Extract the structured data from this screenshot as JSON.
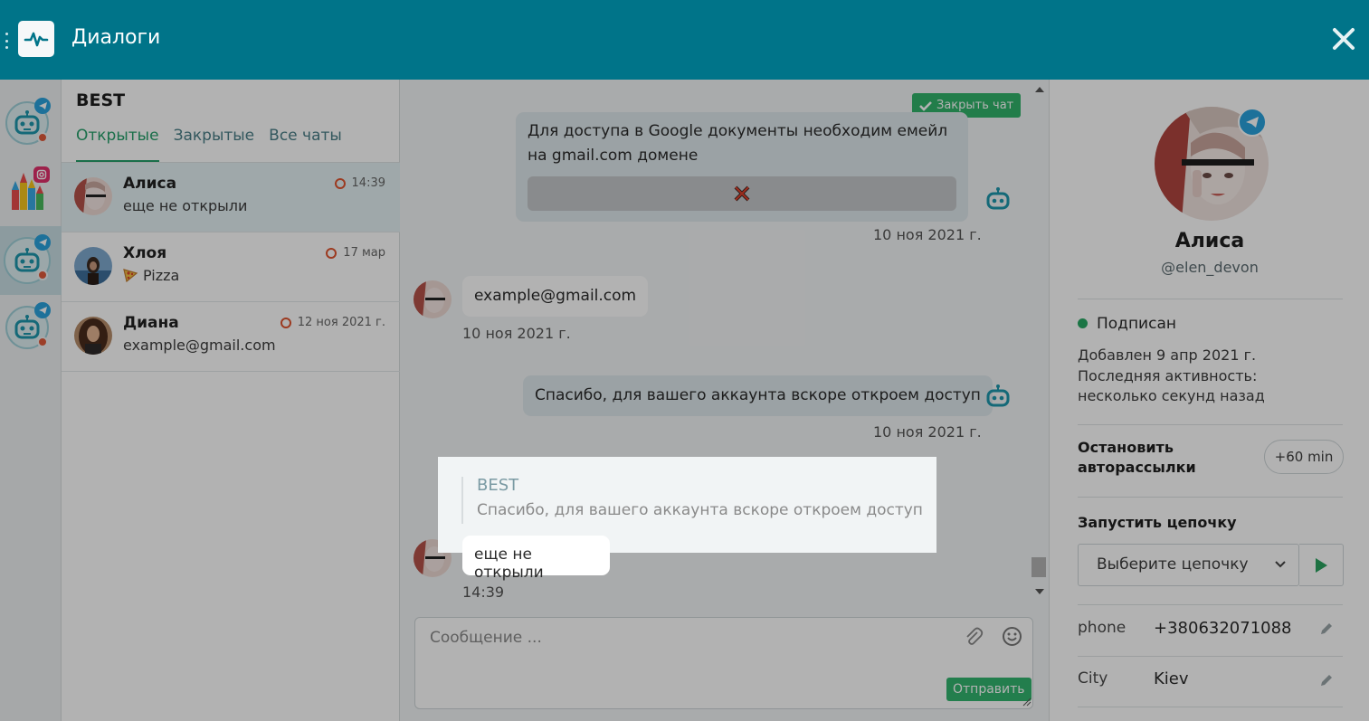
{
  "app": {
    "title": "Диалоги"
  },
  "colors": {
    "topbar": "#007489",
    "accent": "#26a06b",
    "close_chat": "#32b46b",
    "unread": "#e05a3a",
    "telegram": "#2aa3dd",
    "instagram": "#e1306c"
  },
  "channels": [
    {
      "icon": "robot-icon",
      "badge": "telegram-icon"
    },
    {
      "icon": "castle-icon",
      "badge": "instagram-icon"
    },
    {
      "icon": "robot-icon",
      "badge": "telegram-icon"
    },
    {
      "icon": "robot-icon",
      "badge": "telegram-icon"
    }
  ],
  "chatlist": {
    "workspace": "BEST",
    "tabs": [
      "Открытые",
      "Закрытые",
      "Все чаты"
    ],
    "items": [
      {
        "name": "Алиса",
        "last": "еще не открыли",
        "time": "14:39"
      },
      {
        "name": "Хлоя",
        "last": "Pizza",
        "time": "17 мар"
      },
      {
        "name": "Диана",
        "last": "example@gmail.com",
        "time": "12 ноя 2021 г."
      }
    ]
  },
  "chat": {
    "close_label": "Закрыть чат",
    "messages": [
      {
        "text": "Для доступа в Google документы необходим емейл на gmail.com домене",
        "time": "10 ноя 2021 г."
      },
      {
        "text": "example@gmail.com",
        "time": "10 ноя 2021 г."
      },
      {
        "text": "Спасибо, для вашего аккаунта вскоре откроем доступ",
        "time": "10 ноя 2021 г."
      },
      {
        "text": "еще не открыли",
        "time": "14:39"
      }
    ],
    "quote": {
      "title": "BEST",
      "text": "Спасибо, для вашего аккаунта вскоре откроем доступ"
    },
    "composer": {
      "placeholder": "Сообщение ...",
      "send": "Отправить"
    }
  },
  "profile": {
    "name": "Алиса",
    "handle": "@elen_devon",
    "status": "Подписан",
    "added": "Добавлен 9 апр 2021 г.",
    "activity_label": "Последняя активность:",
    "activity_value": "несколько секунд назад",
    "stop_label": "Остановить авторассылки",
    "plus60": "+60 min",
    "chain_label": "Запустить цепочку",
    "chain_placeholder": "Выберите цепочку",
    "fields": [
      {
        "label": "phone",
        "value": "+380632071088"
      },
      {
        "label": "City",
        "value": "Kiev"
      }
    ]
  }
}
